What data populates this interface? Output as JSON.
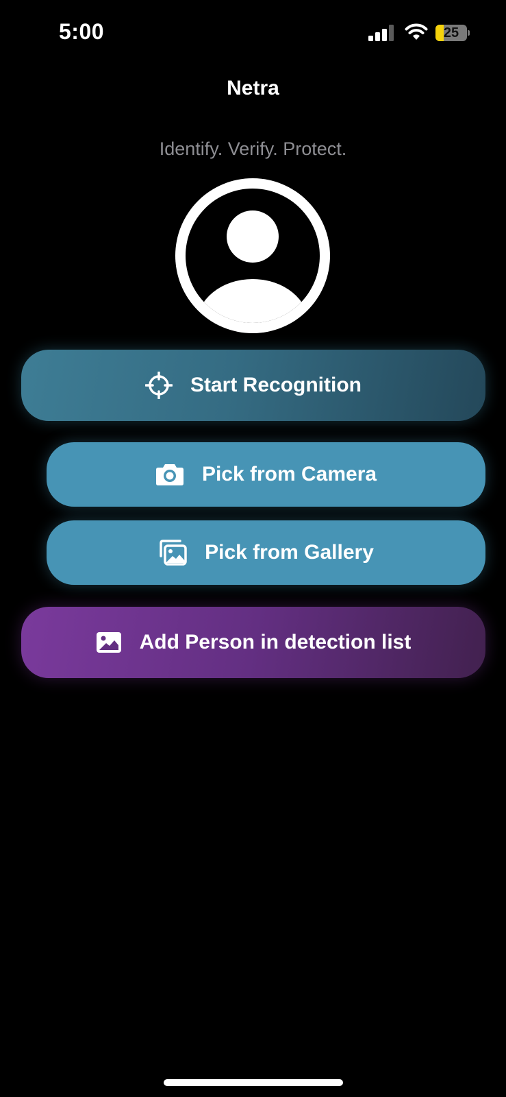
{
  "status_bar": {
    "time": "5:00",
    "battery_level": "25",
    "battery_fraction": 0.25,
    "signal_icon": "cellular-signal-icon",
    "wifi_icon": "wifi-icon"
  },
  "header": {
    "title": "Netra",
    "tagline": "Identify. Verify. Protect."
  },
  "avatar": {
    "icon": "person-avatar-icon"
  },
  "actions": {
    "start_recognition": {
      "label": "Start Recognition",
      "icon": "crosshair-icon"
    },
    "pick_camera": {
      "label": "Pick from Camera",
      "icon": "camera-icon"
    },
    "pick_gallery": {
      "label": "Pick from Gallery",
      "icon": "photo-stack-icon"
    },
    "add_person": {
      "label": "Add Person in detection list",
      "icon": "photo-icon"
    }
  },
  "colors": {
    "background": "#000000",
    "teal": "#4794b5",
    "teal_dark": "#24485a",
    "purple": "#7a3a9c",
    "battery_yellow": "#f5d20b",
    "tagline_gray": "#8e8e93"
  }
}
